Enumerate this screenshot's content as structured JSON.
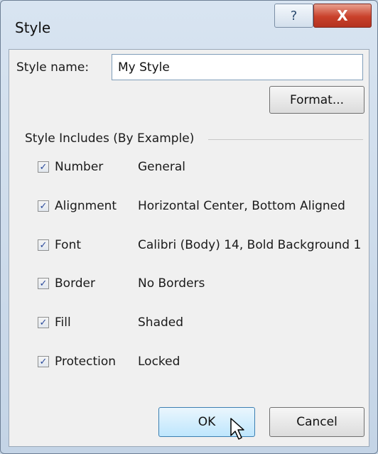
{
  "window": {
    "title": "Style",
    "help_glyph": "?",
    "close_glyph": "X"
  },
  "style_name": {
    "label": "Style name:",
    "value": "My Style"
  },
  "format_button": "Format...",
  "group": {
    "title": "Style Includes (By Example)",
    "items": [
      {
        "label": "Number",
        "value": "General",
        "checked": true
      },
      {
        "label": "Alignment",
        "value": "Horizontal Center, Bottom Aligned",
        "checked": true
      },
      {
        "label": "Font",
        "value": "Calibri (Body) 14, Bold Background 1",
        "checked": true
      },
      {
        "label": "Border",
        "value": "No Borders",
        "checked": true
      },
      {
        "label": "Fill",
        "value": "Shaded",
        "checked": true
      },
      {
        "label": "Protection",
        "value": "Locked",
        "checked": true
      }
    ]
  },
  "buttons": {
    "ok": "OK",
    "cancel": "Cancel"
  },
  "check_glyph": "✓"
}
